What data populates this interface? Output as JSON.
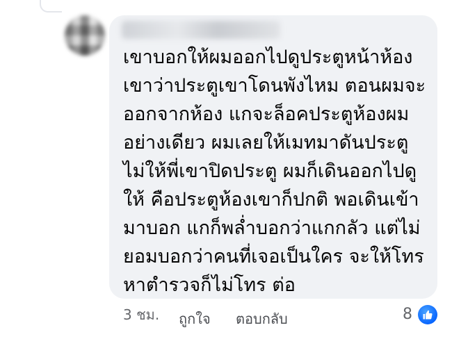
{
  "comment": {
    "text_lines": [
      "เขาบอกให้ผมออกไปดูประตูหน้าห้อง",
      "เขาว่าประตูเขาโดนพังไหม  ตอนผมจะ",
      "ออกจากห้อง แกจะล็อคประตูห้องผม",
      "อย่างเดียว  ผมเลยให้เมทมาดันประตู",
      "ไม่ให้พี่เขาปิดประตู  ผมก็เดินออกไปดู",
      "ให้  คือประตูห้องเขาก็ปกติ  พอเดินเข้า",
      "มาบอก แกก็พล่ำบอกว่าแกกลัว แต่ไม่",
      "ยอมบอกว่าคนที่เจอเป็นใคร จะให้โทร",
      "หาตำรวจก็ไม่โทร ต่อ"
    ],
    "timestamp": "3 ชม.",
    "like_label": "ถูกใจ",
    "reply_label": "ตอบกลับ",
    "reaction_count": "8"
  },
  "icons": {
    "reaction": "like-thumb-icon"
  },
  "colors": {
    "bubble": "#f0f2f5",
    "text": "#050505",
    "meta": "#65676b",
    "like_badge": "#0866ff"
  }
}
